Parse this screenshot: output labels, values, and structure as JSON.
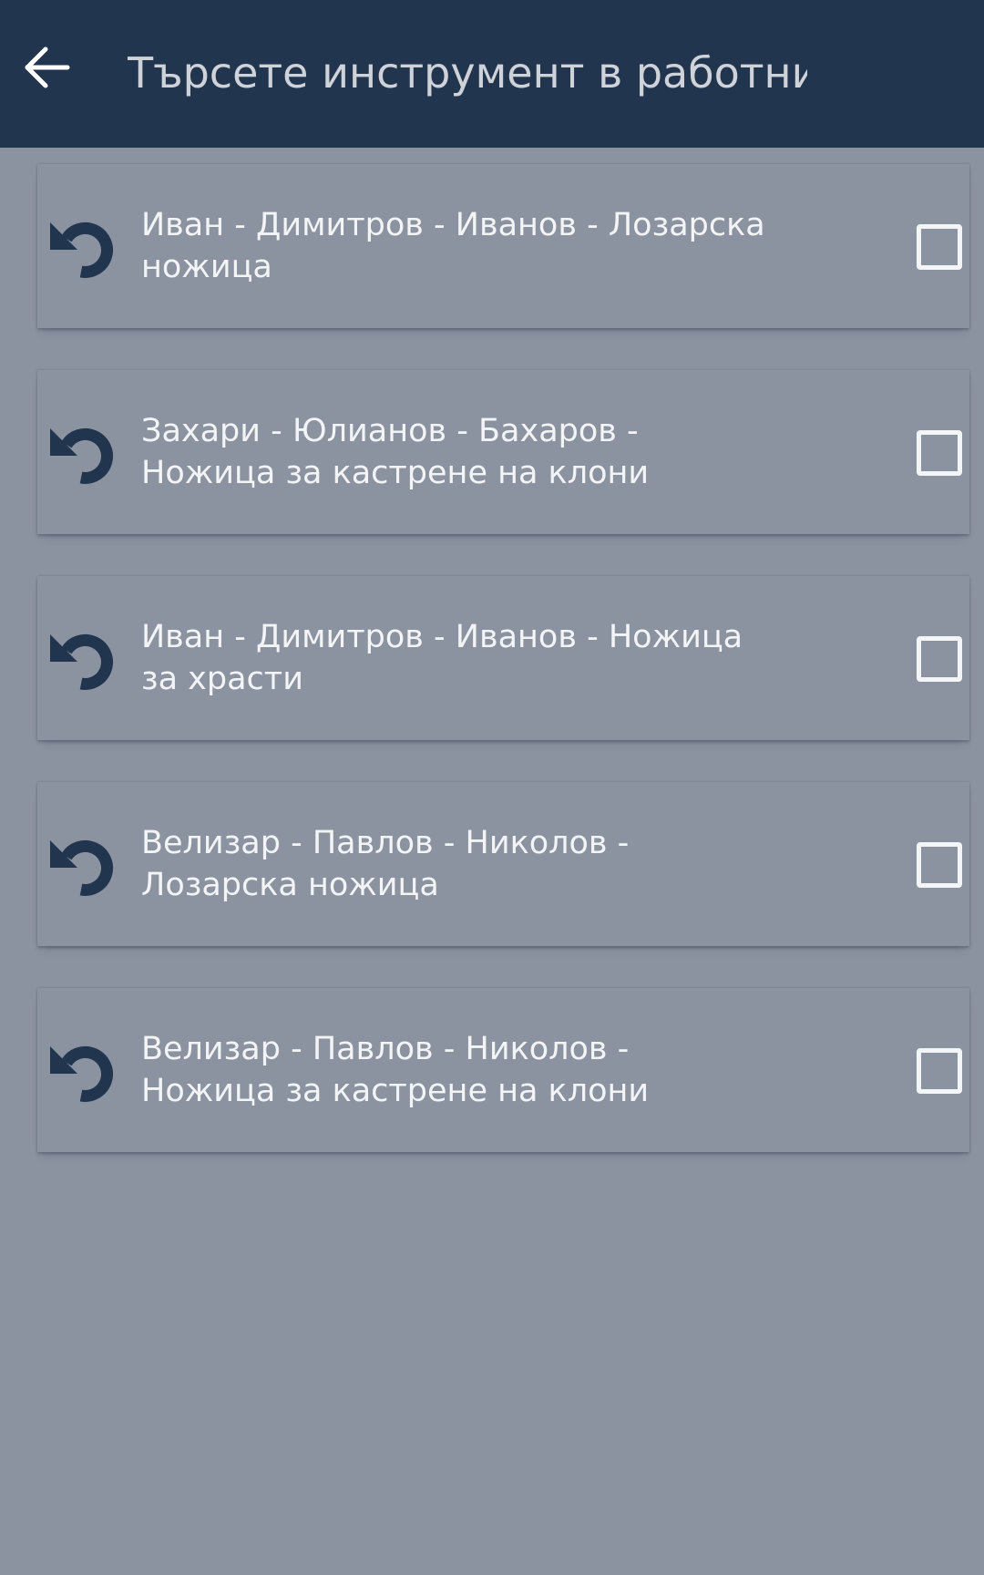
{
  "header": {
    "search_placeholder": "Търсете инструмент в работни",
    "colors": {
      "bar": "#22354f",
      "text": "#cfd3d9"
    }
  },
  "list": {
    "items": [
      {
        "line1": "Иван - Димитров - Иванов - Лозарска",
        "line2": "ножица",
        "checked": false
      },
      {
        "line1": "Захари - Юлианов - Бахаров -",
        "line2": "Ножица за кастрене на клони",
        "checked": false
      },
      {
        "line1": "Иван - Димитров - Иванов - Ножица",
        "line2": "за храсти",
        "checked": false
      },
      {
        "line1": "Велизар - Павлов - Николов -",
        "line2": "Лозарска ножица",
        "checked": false
      },
      {
        "line1": "Велизар - Павлов - Николов -",
        "line2": "Ножица за кастрене на клони",
        "checked": false
      }
    ]
  },
  "icons": {
    "back": "arrow-left-icon",
    "item_action": "undo-icon",
    "item_select": "checkbox-icon"
  },
  "colors": {
    "background": "#8c93a0",
    "icon": "#22354f",
    "card_text": "#f3f4f6"
  }
}
